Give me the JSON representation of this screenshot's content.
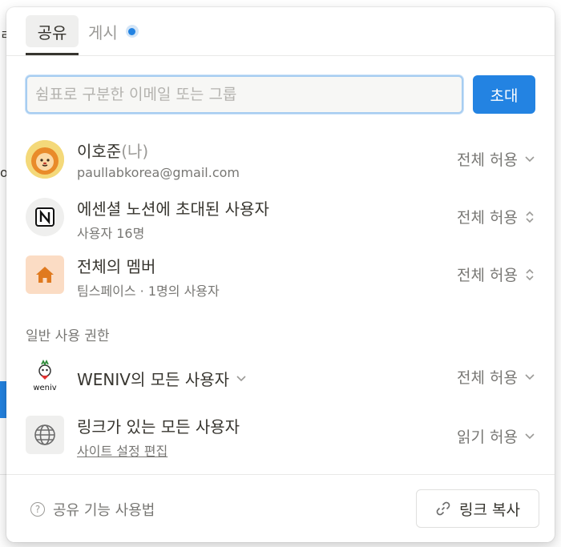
{
  "tabs": [
    {
      "label": "공유"
    },
    {
      "label": "게시"
    }
  ],
  "invite": {
    "placeholder": "쉼표로 구분한 이메일 또는 그룹",
    "button_label": "초대"
  },
  "members": [
    {
      "name": "이호준",
      "me_tag": "(나)",
      "subtitle": "paullabkorea@gmail.com",
      "permission": "전체 허용",
      "avatar": "lion-avatar"
    },
    {
      "name": "에센셜 노션에 초대된 사용자",
      "subtitle": "사용자 16명",
      "permission": "전체 허용",
      "avatar": "notion-logo"
    },
    {
      "name": "전체의 멤버",
      "subtitle": "팀스페이스 · 1명의 사용자",
      "permission": "전체 허용",
      "avatar": "home-icon"
    }
  ],
  "general": {
    "label": "일반 사용 권한",
    "items": [
      {
        "name": "WENIV의 모든 사용자",
        "permission": "전체 허용",
        "avatar": "weniv-logo",
        "logo_text": "weniv"
      },
      {
        "name": "링크가 있는 모든 사용자",
        "subtitle": "사이트 설정 편집",
        "permission": "읽기 허용",
        "avatar": "globe-icon"
      }
    ]
  },
  "footer": {
    "help_label": "공유 기능 사용법",
    "copy_link_label": "링크 복사"
  },
  "colors": {
    "accent": "#2383e2",
    "home_icon": "#e07a1f",
    "home_bg": "#fbdcc4"
  }
}
